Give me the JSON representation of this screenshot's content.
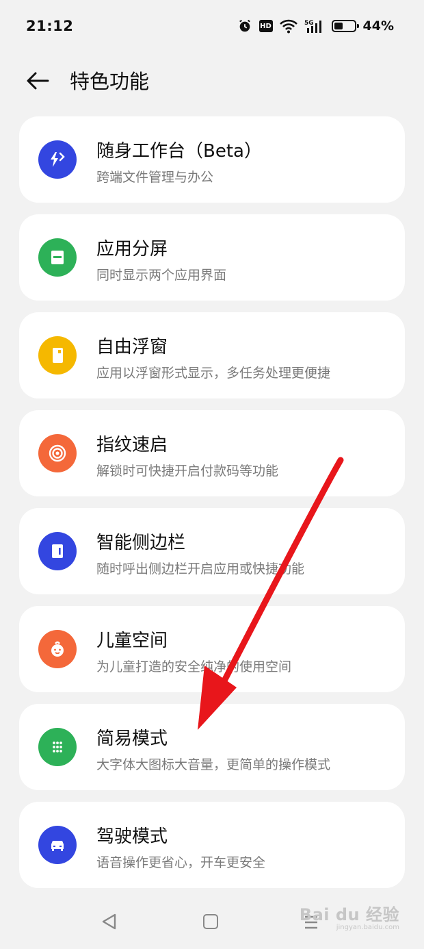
{
  "status_bar": {
    "time": "21:12",
    "hd_label": "HD",
    "network_label": "5G",
    "battery_percent": "44%",
    "battery_level": 0.44
  },
  "header": {
    "title": "特色功能",
    "back_icon": "arrow-left-icon"
  },
  "features": [
    {
      "title": "随身工作台（Beta）",
      "subtitle": "跨端文件管理与办公",
      "icon": "workbench-icon",
      "color": "#3346e0"
    },
    {
      "title": "应用分屏",
      "subtitle": "同时显示两个应用界面",
      "icon": "split-screen-icon",
      "color": "#2db158"
    },
    {
      "title": "自由浮窗",
      "subtitle": "应用以浮窗形式显示，多任务处理更便捷",
      "icon": "floating-window-icon",
      "color": "#f5b800"
    },
    {
      "title": "指纹速启",
      "subtitle": "解锁时可快捷开启付款码等功能",
      "icon": "fingerprint-icon",
      "color": "#f4683a"
    },
    {
      "title": "智能侧边栏",
      "subtitle": "随时呼出侧边栏开启应用或快捷功能",
      "icon": "sidebar-icon",
      "color": "#3346e0"
    },
    {
      "title": "儿童空间",
      "subtitle": "为儿童打造的安全纯净的使用空间",
      "icon": "kid-face-icon",
      "color": "#f4683a"
    },
    {
      "title": "简易模式",
      "subtitle": "大字体大图标大音量，更简单的操作模式",
      "icon": "grid-dots-icon",
      "color": "#2db158"
    },
    {
      "title": "驾驶模式",
      "subtitle": "语音操作更省心，开车更安全",
      "icon": "car-icon",
      "color": "#3346e0"
    }
  ],
  "nav_bar": {
    "back_icon": "triangle-back-icon",
    "home_icon": "square-home-icon",
    "menu_icon": "menu-lines-icon"
  },
  "watermark": {
    "logo": "Bai du 经验",
    "url": "jingyan.baidu.com"
  },
  "annotation": {
    "arrow_color": "#e8161b"
  }
}
